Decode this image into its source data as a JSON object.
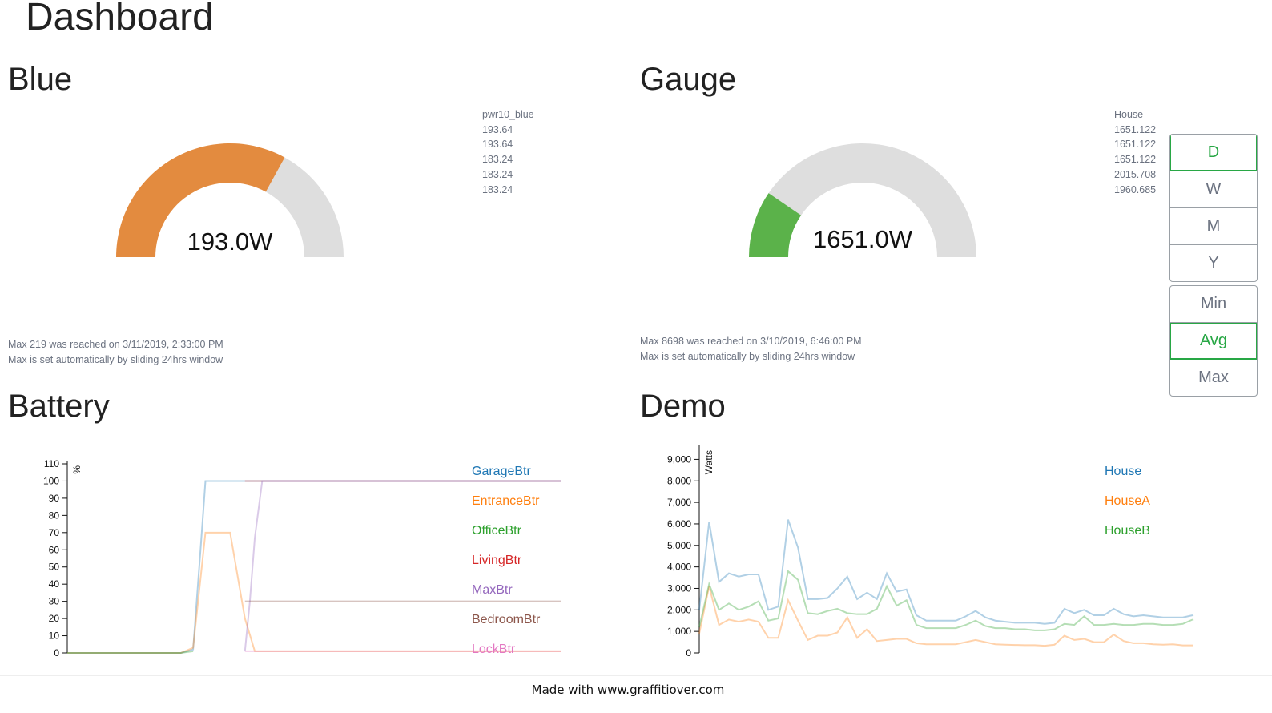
{
  "page": {
    "title": "Dashboard",
    "footer": "Made with www.graffitiover.com"
  },
  "colors": {
    "blue_gauge": "#e38b3f",
    "gauge_track": "#dedede",
    "gauge_green": "#5bb24a",
    "active_btn": "#28a745",
    "series": [
      "#1f77b4",
      "#ff7f0e",
      "#2ca02c",
      "#d62728",
      "#9467bd",
      "#8c564b",
      "#e377c2"
    ]
  },
  "blue": {
    "title": "Blue",
    "value_label": "193.0W",
    "fraction": 0.66,
    "readings_title": "pwr10_blue",
    "readings": [
      "193.64",
      "193.64",
      "183.24",
      "183.24",
      "183.24"
    ],
    "max_note": "Max 219 was reached on 3/11/2019, 2:33:00 PM",
    "max_info": "Max is set automatically by sliding 24hrs window"
  },
  "gauge": {
    "title": "Gauge",
    "value_label": "1651.0W",
    "fraction": 0.19,
    "readings_title": "House",
    "readings": [
      "1651.122",
      "1651.122",
      "1651.122",
      "2015.708",
      "1960.685"
    ],
    "max_note": "Max 8698 was reached on 3/10/2019, 6:46:00 PM",
    "max_info": "Max is set automatically by sliding 24hrs window"
  },
  "period_buttons": [
    {
      "label": "D",
      "active": true
    },
    {
      "label": "W",
      "active": false
    },
    {
      "label": "M",
      "active": false
    },
    {
      "label": "Y",
      "active": false
    }
  ],
  "agg_buttons": [
    {
      "label": "Min",
      "active": false
    },
    {
      "label": "Avg",
      "active": true
    },
    {
      "label": "Max",
      "active": false
    }
  ],
  "battery": {
    "title": "Battery",
    "chart_data": {
      "type": "line",
      "ylabel": "%",
      "ylim": [
        0,
        110
      ],
      "yticks": [
        "0",
        "10",
        "20",
        "30",
        "40",
        "50",
        "60",
        "70",
        "80",
        "90",
        "100",
        "110"
      ],
      "legend_position": "right",
      "series": [
        {
          "name": "GarageBtr",
          "color": "#1f77b4",
          "points": [
            [
              0,
              0
            ],
            [
              0.05,
              0
            ],
            [
              0.1,
              0
            ],
            [
              0.15,
              0
            ],
            [
              0.2,
              0
            ],
            [
              0.23,
              0
            ],
            [
              0.255,
              2
            ],
            [
              0.27,
              60
            ],
            [
              0.28,
              100
            ],
            [
              0.35,
              100
            ],
            [
              0.45,
              100
            ],
            [
              0.6,
              100
            ],
            [
              0.75,
              100
            ],
            [
              0.9,
              100
            ],
            [
              1.0,
              100
            ]
          ]
        },
        {
          "name": "EntranceBtr",
          "color": "#ff7f0e",
          "points": [
            [
              0,
              0
            ],
            [
              0.05,
              0
            ],
            [
              0.1,
              0
            ],
            [
              0.15,
              0
            ],
            [
              0.2,
              0
            ],
            [
              0.23,
              0
            ],
            [
              0.255,
              3
            ],
            [
              0.28,
              70
            ],
            [
              0.3,
              70
            ],
            [
              0.33,
              70
            ],
            [
              0.36,
              20
            ],
            [
              0.38,
              1
            ],
            [
              0.45,
              1
            ],
            [
              0.6,
              1
            ],
            [
              0.75,
              1
            ],
            [
              0.9,
              1
            ],
            [
              1.0,
              1
            ]
          ]
        },
        {
          "name": "OfficeBtr",
          "color": "#2ca02c",
          "points": [
            [
              0,
              0
            ],
            [
              0.1,
              0
            ],
            [
              0.2,
              0
            ],
            [
              0.23,
              0
            ],
            [
              0.255,
              1
            ]
          ]
        },
        {
          "name": "LivingBtr",
          "color": "#d62728",
          "points": [
            [
              0.36,
              100
            ],
            [
              0.5,
              100
            ],
            [
              0.7,
              100
            ],
            [
              1.0,
              100
            ]
          ]
        },
        {
          "name": "MaxBtr",
          "color": "#9467bd",
          "points": [
            [
              0.36,
              1
            ],
            [
              0.37,
              30
            ],
            [
              0.38,
              67
            ],
            [
              0.395,
              100
            ],
            [
              0.5,
              100
            ],
            [
              0.7,
              100
            ],
            [
              1.0,
              100
            ]
          ]
        },
        {
          "name": "BedroomBtr",
          "color": "#8c564b",
          "points": [
            [
              0.36,
              30
            ],
            [
              0.5,
              30
            ],
            [
              0.7,
              30
            ],
            [
              1.0,
              30
            ]
          ]
        },
        {
          "name": "LockBtr",
          "color": "#e377c2",
          "points": [
            [
              0.36,
              1
            ],
            [
              0.5,
              1
            ],
            [
              0.7,
              1
            ],
            [
              1.0,
              1
            ]
          ]
        }
      ]
    }
  },
  "demo": {
    "title": "Demo",
    "chart_data": {
      "type": "line",
      "ylabel": "Watts",
      "ylim": [
        0,
        9500
      ],
      "yticks": [
        "0",
        "1,000",
        "2,000",
        "3,000",
        "4,000",
        "5,000",
        "6,000",
        "7,000",
        "8,000",
        "9,000"
      ],
      "legend_position": "right",
      "series": [
        {
          "name": "House",
          "color": "#1f77b4",
          "values": [
            2000,
            6100,
            3300,
            3700,
            3550,
            3650,
            3650,
            2000,
            2150,
            6200,
            4900,
            2500,
            2500,
            2550,
            3000,
            3550,
            2500,
            2800,
            2500,
            3700,
            2850,
            2950,
            1750,
            1500,
            1500,
            1500,
            1500,
            1700,
            1950,
            1650,
            1500,
            1450,
            1400,
            1400,
            1400,
            1350,
            1400,
            2050,
            1850,
            2000,
            1750,
            1750,
            2050,
            1800,
            1700,
            1750,
            1700,
            1650,
            1650,
            1650,
            1750
          ]
        },
        {
          "name": "HouseA",
          "color": "#ff7f0e",
          "values": [
            900,
            3100,
            1300,
            1550,
            1450,
            1550,
            1450,
            700,
            700,
            2450,
            1500,
            600,
            800,
            800,
            950,
            1650,
            700,
            1100,
            550,
            600,
            650,
            650,
            450,
            400,
            400,
            400,
            400,
            500,
            600,
            500,
            400,
            380,
            370,
            360,
            360,
            330,
            380,
            800,
            600,
            650,
            500,
            500,
            850,
            550,
            450,
            450,
            400,
            380,
            400,
            350,
            350
          ]
        },
        {
          "name": "HouseB",
          "color": "#2ca02c",
          "values": [
            1200,
            3200,
            2000,
            2300,
            2000,
            2150,
            2400,
            1500,
            1600,
            3800,
            3400,
            1850,
            1800,
            1950,
            2050,
            1850,
            1800,
            1800,
            2050,
            3100,
            2200,
            2450,
            1300,
            1150,
            1150,
            1150,
            1150,
            1300,
            1500,
            1250,
            1150,
            1150,
            1100,
            1100,
            1050,
            1050,
            1100,
            1350,
            1300,
            1700,
            1300,
            1300,
            1350,
            1300,
            1300,
            1350,
            1350,
            1300,
            1300,
            1350,
            1550
          ]
        }
      ]
    }
  }
}
